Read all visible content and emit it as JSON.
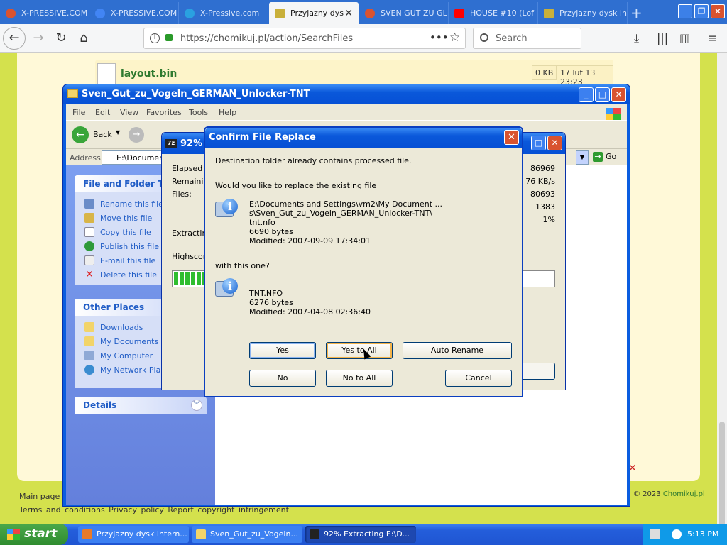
{
  "browser": {
    "tabs": [
      {
        "label": "X-PRESSIVE.COM",
        "color": "#d9532f"
      },
      {
        "label": "X-PRESSIVE.COM",
        "color": "#4285f4"
      },
      {
        "label": "X-Pressive.com",
        "color": "#2aa1e0"
      },
      {
        "label": "Przyjazny dys",
        "color": "#c9b03a",
        "active": true
      },
      {
        "label": "SVEN GUT ZU GL",
        "color": "#d9532f"
      },
      {
        "label": "HOUSE #10 (Lof",
        "color": "#ff0000"
      },
      {
        "label": "Przyjazny dysk in",
        "color": "#c9b03a"
      }
    ],
    "new_tab_icon": "plus-icon",
    "url": "https://chomikuj.pl/action/SearchFiles",
    "search_placeholder": "Search"
  },
  "page": {
    "file_name": "layout.bin",
    "file_size": "0 KB",
    "file_date": "17 lut 13 23:23",
    "footer_main": "Main page",
    "footer_links": "Terms and conditions  Privacy policy  Report copyright infringement",
    "copyright_prefix": "© 2023",
    "copyright_brand": "Chomikuj.pl"
  },
  "explorer": {
    "title": "Sven_Gut_zu_Vogeln_GERMAN_Unlocker-TNT",
    "menu": [
      "File",
      "Edit",
      "View",
      "Favorites",
      "Tools",
      "Help"
    ],
    "back_label": "Back",
    "address_label": "Address",
    "address_value": "E:\\Document",
    "go_label": "Go",
    "file_tasks_title": "File and Folder Tasks",
    "file_tasks": [
      "Rename this file",
      "Move this file",
      "Copy this file",
      "Publish this file to",
      "E-mail this file",
      "Delete this file"
    ],
    "other_places_title": "Other Places",
    "other_places": [
      "Downloads",
      "My Documents",
      "My Computer",
      "My Network Places"
    ],
    "details_title": "Details"
  },
  "zip": {
    "title": "92% E",
    "icon_label": "7z",
    "labels": [
      "Elapsed t",
      "Remainin",
      "Files:"
    ],
    "values": [
      "86969",
      "76 KB/s",
      "80693",
      "1383",
      "1%"
    ],
    "extracting": "Extracting",
    "highscore": "Highscore",
    "progress": 0.92
  },
  "dialog": {
    "title": "Confirm File Replace",
    "line1": "Destination folder already contains processed file.",
    "line2": "Would you like to replace the existing file",
    "existing_path1": "E:\\Documents and Settings\\vm2\\My Document ...",
    "existing_path2": "s\\Sven_Gut_zu_Vogeln_GERMAN_Unlocker-TNT\\",
    "existing_name": "tnt.nfo",
    "existing_size": "6690 bytes",
    "existing_modified": "Modified: 2007-09-09 17:34:01",
    "line3": "with this one?",
    "new_name": "TNT.NFO",
    "new_size": "6276 bytes",
    "new_modified": "Modified: 2007-04-08 02:36:40",
    "buttons": {
      "yes": "Yes",
      "yes_all": "Yes to All",
      "auto_rename": "Auto Rename",
      "no": "No",
      "no_all": "No to All",
      "cancel": "Cancel"
    }
  },
  "taskbar": {
    "start": "start",
    "tasks": [
      "Przyjazny dysk intern...",
      "Sven_Gut_zu_Vogeln...",
      "92% Extracting E:\\D..."
    ],
    "clock": "5:13 PM"
  }
}
